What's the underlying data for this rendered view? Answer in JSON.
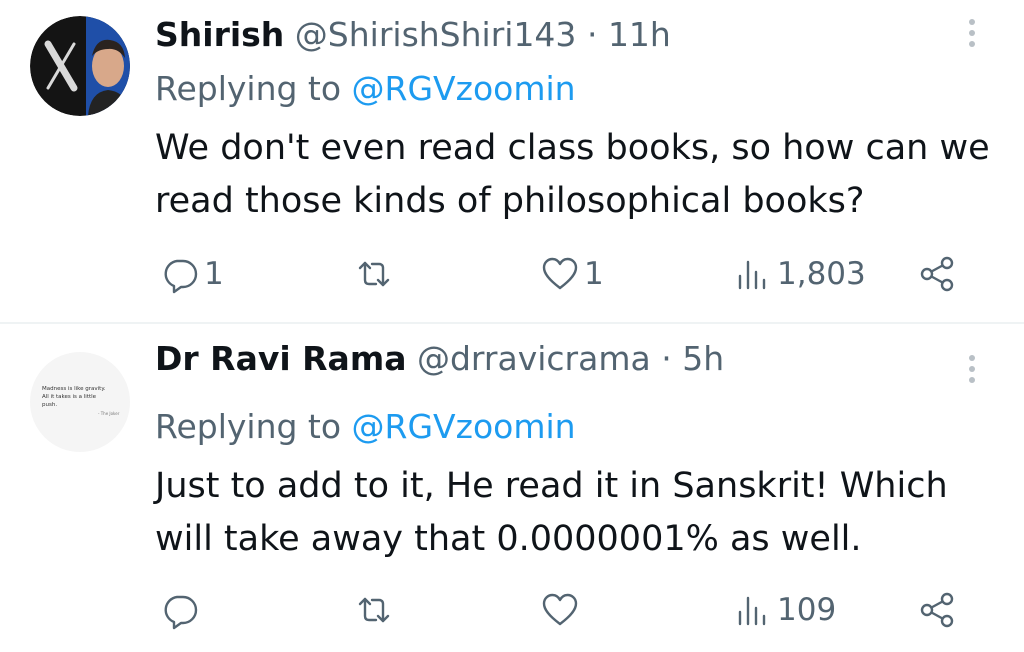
{
  "tweets": [
    {
      "name": "Shirish",
      "handle": "@ShirishShiri143",
      "separator": "·",
      "time": "11h",
      "replying_prefix": "Replying to ",
      "replying_to": "@RGVzoomin",
      "text": "We don't even read class books, so how can we read those kinds of philosophical books?",
      "reply_count": "1",
      "retweet_count": "",
      "like_count": "1",
      "views": "1,803"
    },
    {
      "name": "Dr Ravi Rama",
      "handle": "@drravicrama",
      "separator": "·",
      "time": "5h",
      "replying_prefix": "Replying to ",
      "replying_to": "@RGVzoomin",
      "text": "Just to add to it, He read it in Sanskrit! Which will take away that  0.0000001% as well.",
      "avatar_quote": "Madness is like gravity. All it takes is a little push.",
      "avatar_quote_author": "- The Joker",
      "reply_count": "",
      "retweet_count": "",
      "like_count": "",
      "views": "109"
    }
  ],
  "colors": {
    "text": "#0f1419",
    "secondary": "#536471",
    "link": "#1d9bf0",
    "divider": "#eff3f4"
  },
  "icons": [
    "x-logo-icon",
    "reply-icon",
    "retweet-icon",
    "like-icon",
    "views-icon",
    "share-icon",
    "more-icon"
  ]
}
